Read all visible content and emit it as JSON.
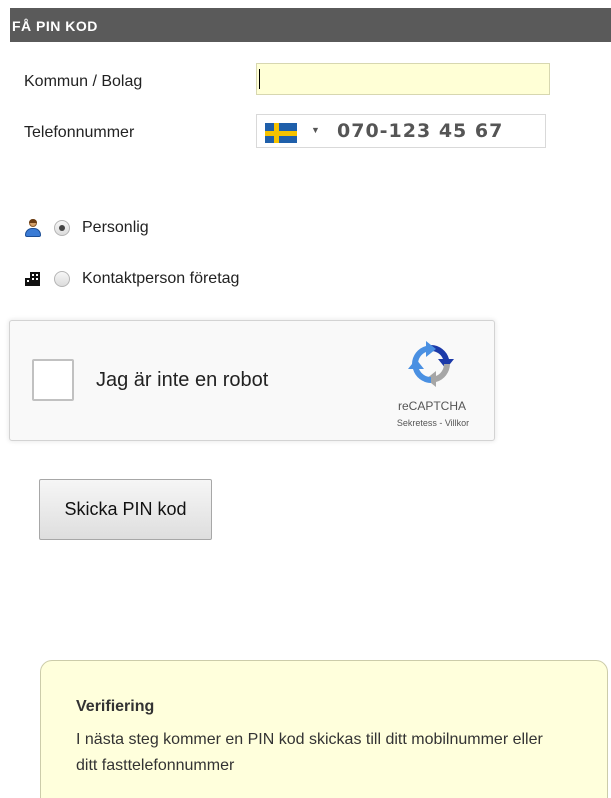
{
  "header": {
    "title": "FÅ PIN KOD"
  },
  "form": {
    "kommun_label": "Kommun / Bolag",
    "kommun_value": "",
    "phone_label": "Telefonnummer",
    "phone_placeholder": "070-123 45 67",
    "phone_country": "Sweden",
    "phone_country_flag": "flag-se-icon"
  },
  "roles": {
    "personal": {
      "label": "Personlig",
      "icon": "user-icon",
      "checked": true
    },
    "company": {
      "label": "Kontaktperson företag",
      "icon": "building-icon",
      "checked": false
    }
  },
  "captcha": {
    "label": "Jag är inte en robot",
    "brand": "reCAPTCHA",
    "links": "Sekretess - Villkor",
    "logo_icon": "recaptcha-logo-icon"
  },
  "actions": {
    "submit_label": "Skicka PIN kod"
  },
  "info": {
    "title": "Verifiering",
    "text": "I nästa steg kommer en PIN kod skickas till ditt mobilnummer eller ditt fasttelefonnummer"
  },
  "colors": {
    "header_bg": "#5a5a5a",
    "input_bg": "#ffffd6",
    "info_bg": "#ffffdc"
  }
}
